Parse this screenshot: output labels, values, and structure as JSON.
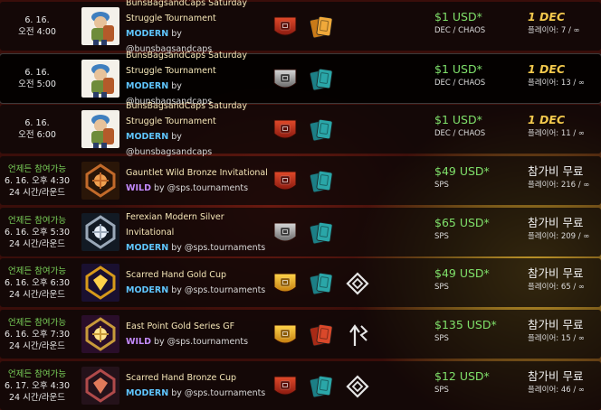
{
  "rows": [
    {
      "time_line1": "6. 16.",
      "time_line2": "오전 4:00",
      "open_text": "",
      "round_text": "",
      "thumb": "avatar-bunsbags",
      "name": "BunsBagsandCaps Saturday",
      "name2": "Struggle Tournament",
      "format": "MODERN",
      "by": "by @bunsbagsandcaps",
      "badges": [
        "red-league-icon",
        "gold-cards-icon"
      ],
      "prize": "$1 USD*",
      "prize_sub": "DEC / CHAOS",
      "entry": "1 DEC",
      "players": "플레이어: 7 / ∞"
    },
    {
      "time_line1": "6. 16.",
      "time_line2": "오전 5:00",
      "open_text": "",
      "round_text": "",
      "thumb": "avatar-bunsbags",
      "name": "BunsBagsandCaps Saturday",
      "name2": "Struggle Tournament",
      "format": "MODERN",
      "by": "by @bunsbagsandcaps",
      "badges": [
        "silver-league-icon",
        "teal-cards-icon"
      ],
      "prize": "$1 USD*",
      "prize_sub": "DEC / CHAOS",
      "entry": "1 DEC",
      "players": "플레이어: 13 / ∞"
    },
    {
      "time_line1": "6. 16.",
      "time_line2": "오전 6:00",
      "open_text": "",
      "round_text": "",
      "thumb": "avatar-bunsbags",
      "name": "BunsBagsandCaps Saturday",
      "name2": "Struggle Tournament",
      "format": "MODERN",
      "by": "by @bunsbagsandcaps",
      "badges": [
        "red-league-icon",
        "teal-cards-icon"
      ],
      "prize": "$1 USD*",
      "prize_sub": "DEC / CHAOS",
      "entry": "1 DEC",
      "players": "플레이어: 11 / ∞"
    },
    {
      "time_line1": "6. 16. 오후 4:30",
      "time_line2": "24 시간/라운드",
      "open_text": "언제든 참여가능",
      "round_text": "",
      "thumb": "emblem-bronze",
      "name": "Gauntlet Wild Bronze Invitational",
      "name2": "",
      "format": "WILD",
      "by": "by @sps.tournaments",
      "badges": [
        "red-league-icon",
        "teal-cards-icon"
      ],
      "prize": "$49 USD*",
      "prize_sub": "SPS",
      "entry": "참가비 무료",
      "players": "플레이어: 216 / ∞"
    },
    {
      "time_line1": "6. 16. 오후 5:30",
      "time_line2": "24 시간/라운드",
      "open_text": "언제든 참여가능",
      "round_text": "",
      "thumb": "emblem-silver",
      "name": "Ferexian Modern Silver Invitational",
      "name2": "",
      "format": "MODERN",
      "by": "by @sps.tournaments",
      "badges": [
        "silver-league-icon",
        "teal-cards-icon"
      ],
      "prize": "$65 USD*",
      "prize_sub": "SPS",
      "entry": "참가비 무료",
      "players": "플레이어: 209 / ∞"
    },
    {
      "time_line1": "6. 16. 오후 6:30",
      "time_line2": "24 시간/라운드",
      "open_text": "언제든 참여가능",
      "round_text": "",
      "thumb": "emblem-gold-hand",
      "name": "Scarred Hand Gold Cup",
      "name2": "",
      "format": "MODERN",
      "by": "by @sps.tournaments",
      "badges": [
        "gold-league-icon",
        "teal-cards-icon",
        "diamond-element-icon"
      ],
      "prize": "$49 USD*",
      "prize_sub": "SPS",
      "entry": "참가비 무료",
      "players": "플레이어: 65 / ∞"
    },
    {
      "time_line1": "6. 16. 오후 7:30",
      "time_line2": "24 시간/라운드",
      "open_text": "언제든 참여가능",
      "round_text": "",
      "thumb": "emblem-eastpoint",
      "name": "East Point Gold Series GF",
      "name2": "",
      "format": "WILD",
      "by": "by @sps.tournaments",
      "badges": [
        "gold-league-icon",
        "red-cards-icon",
        "arrow-rule-icon"
      ],
      "prize": "$135 USD*",
      "prize_sub": "SPS",
      "entry": "참가비 무료",
      "players": "플레이어: 15 / ∞"
    },
    {
      "time_line1": "6. 17. 오후 4:30",
      "time_line2": "24 시간/라운드",
      "open_text": "언제든 참여가능",
      "round_text": "",
      "thumb": "emblem-bronze-hand",
      "name": "Scarred Hand Bronze Cup",
      "name2": "",
      "format": "MODERN",
      "by": "by @sps.tournaments",
      "badges": [
        "red-league-icon",
        "teal-cards-icon",
        "diamond-element-icon"
      ],
      "prize": "$12 USD*",
      "prize_sub": "SPS",
      "entry": "참가비 무료",
      "players": "플레이어: 46 / ∞"
    }
  ]
}
